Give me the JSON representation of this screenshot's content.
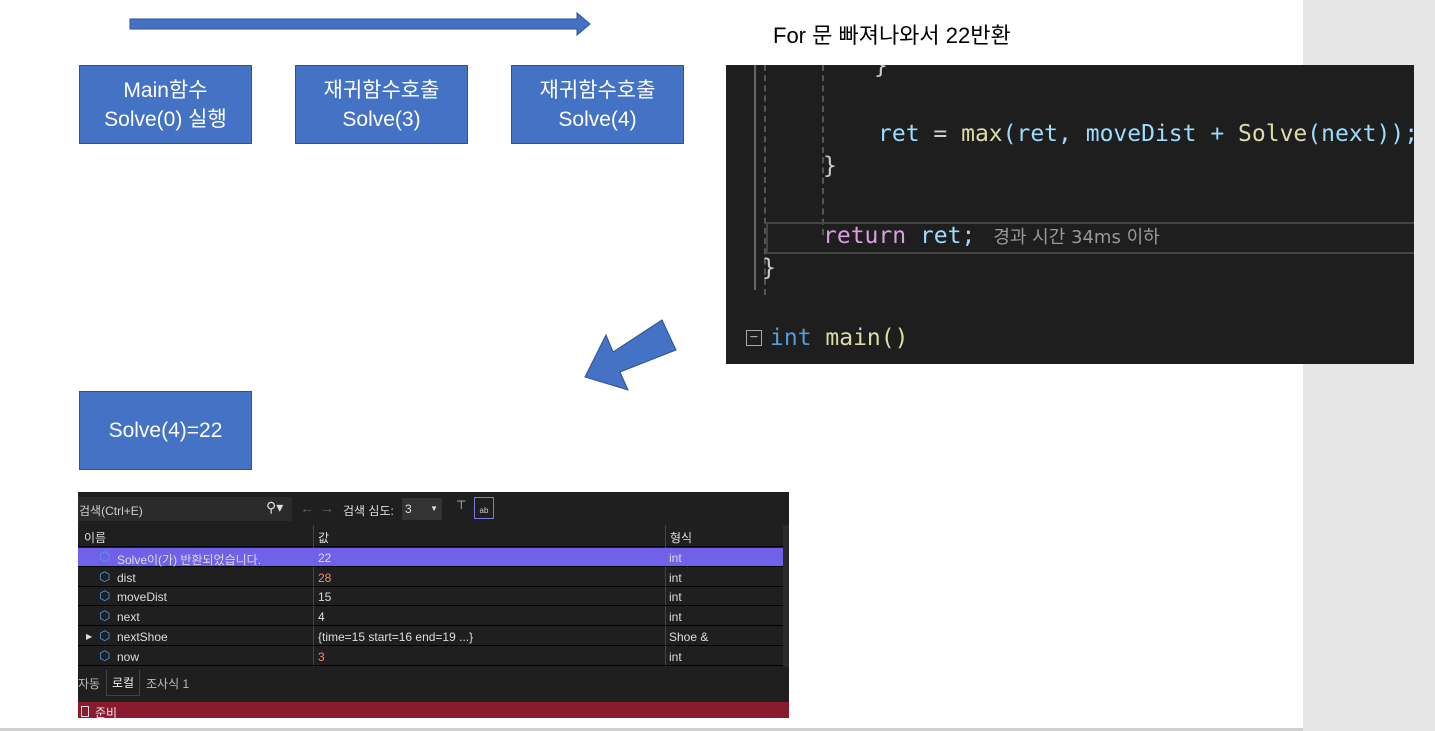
{
  "title": "For 문 빠져나와서 22반환",
  "boxes": [
    {
      "line1": "Main함수",
      "line2": "Solve(0) 실행"
    },
    {
      "line1": "재귀함수호출",
      "line2": "Solve(3)"
    },
    {
      "line1": "재귀함수호출",
      "line2": "Solve(4)"
    },
    {
      "line1": "Solve(4)=22"
    }
  ],
  "code": {
    "brace1": "}",
    "line_ret_a": "ret",
    "line_ret_b": " = ",
    "line_ret_c": "max",
    "line_ret_d": "(ret, moveDist + ",
    "line_ret_e": "Solve",
    "line_ret_f": "(next));",
    "brace2": "}",
    "return_kw": "return",
    "return_var": " ret;",
    "elapsed": "경과 시간 34ms 이하",
    "brace3": "}",
    "int_kw": "int",
    "main_fn": " main()",
    "colors": {
      "bg": "#1e1e1e",
      "keyword": "#569cd6",
      "control": "#d8a0df",
      "variable": "#9cdcfe",
      "function": "#dcdcaa"
    }
  },
  "debugger": {
    "search_placeholder": "검색(Ctrl+E)",
    "search_depth_label": "검색 심도:",
    "search_depth_value": "3",
    "columns": [
      "이름",
      "값",
      "형식"
    ],
    "rows": [
      {
        "name": "Solve이(가) 반환되었습니다.",
        "value": "22",
        "type": "int",
        "selected": true
      },
      {
        "name": "dist",
        "value": "28",
        "type": "int",
        "changed": true
      },
      {
        "name": "moveDist",
        "value": "15",
        "type": "int"
      },
      {
        "name": "next",
        "value": "4",
        "type": "int"
      },
      {
        "name": "nextShoe",
        "value": "{time=15 start=16 end=19 ...}",
        "type": "Shoe &",
        "expandable": true
      },
      {
        "name": "now",
        "value": "3",
        "type": "int",
        "changed": true
      }
    ],
    "tabs": [
      "자동",
      "로컬",
      "조사식 1"
    ],
    "active_tab": "로컬",
    "status": "준비",
    "colors": {
      "selected": "#7160e8",
      "status_bar": "#8a1a2e",
      "changed_value": "#f48771"
    }
  }
}
